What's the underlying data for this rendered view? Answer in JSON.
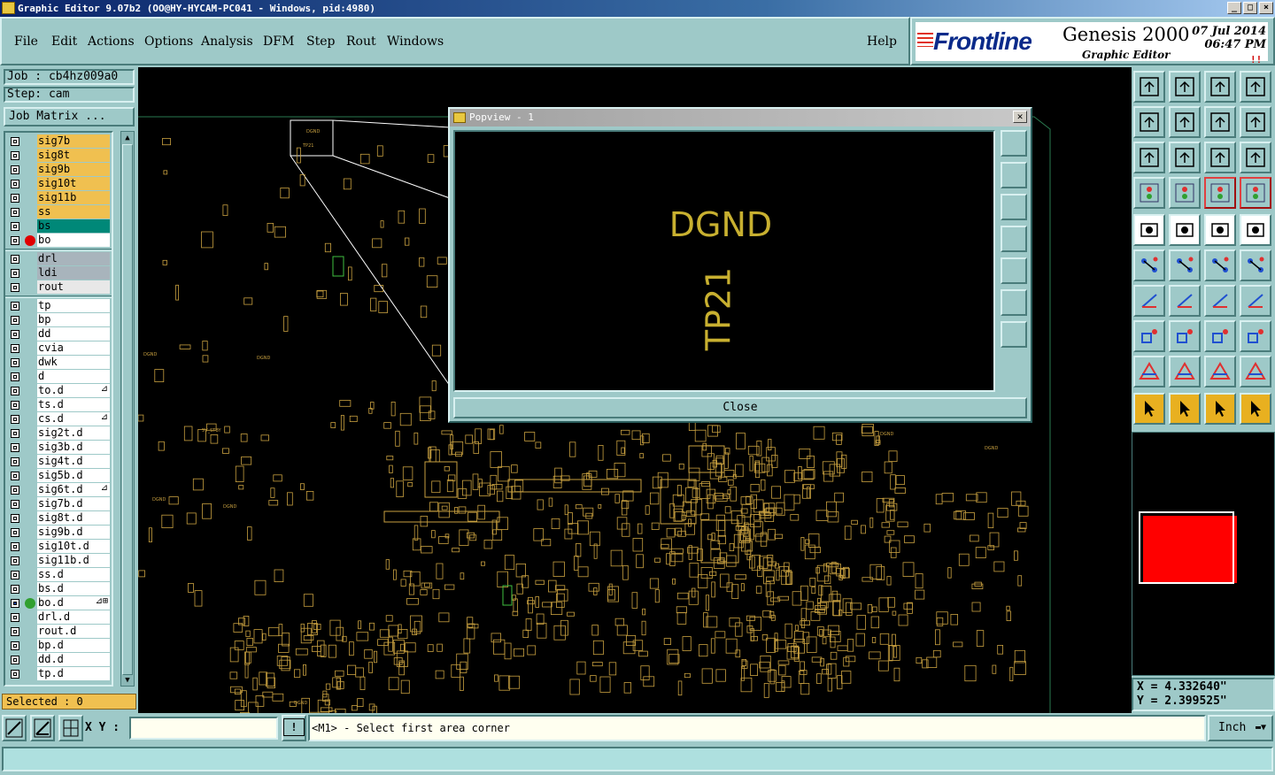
{
  "window": {
    "title": "Graphic Editor 9.07b2 (OO@HY-HYCAM-PC041 - Windows, pid:4980)",
    "controls": [
      "_",
      "□",
      "×"
    ]
  },
  "menu": [
    "File",
    "Edit",
    "Actions",
    "Options",
    "Analysis",
    "DFM",
    "Step",
    "Rout",
    "Windows"
  ],
  "help": "Help",
  "brand": {
    "logo": "Frontline",
    "product": "Genesis 2000",
    "subtitle": "Graphic Editor",
    "date": "07 Jul 2014",
    "time": "06:47 PM",
    "alarm": "!!"
  },
  "job": {
    "job_label": "Job : cb4hz009a0",
    "step_label": "Step: cam",
    "matrix_button": "Job Matrix ..."
  },
  "layers": {
    "group1": [
      {
        "name": "sig7b",
        "bg": "#f0c050"
      },
      {
        "name": "sig8t",
        "bg": "#f0c050"
      },
      {
        "name": "sig9b",
        "bg": "#f0c050"
      },
      {
        "name": "sig10t",
        "bg": "#f0c050"
      },
      {
        "name": "sig11b",
        "bg": "#f0c050"
      },
      {
        "name": "ss",
        "bg": "#f0c050"
      },
      {
        "name": "bs",
        "bg": "#008878"
      },
      {
        "name": "bo",
        "bg": "#ffffff",
        "dot": "#e00000"
      }
    ],
    "group2": [
      {
        "name": "drl",
        "bg": "#a8b4bc"
      },
      {
        "name": "ldi",
        "bg": "#a8b4bc"
      },
      {
        "name": "rout",
        "bg": "#e8e8e8"
      }
    ],
    "group3": [
      {
        "name": "tp"
      },
      {
        "name": "bp"
      },
      {
        "name": "dd"
      },
      {
        "name": "cvia"
      },
      {
        "name": "dwk"
      },
      {
        "name": "d"
      },
      {
        "name": "to.d",
        "mark": "⊿"
      },
      {
        "name": "ts.d"
      },
      {
        "name": "cs.d",
        "mark": "⊿"
      },
      {
        "name": "sig2t.d"
      },
      {
        "name": "sig3b.d"
      },
      {
        "name": "sig4t.d"
      },
      {
        "name": "sig5b.d"
      },
      {
        "name": "sig6t.d",
        "mark": "⊿"
      },
      {
        "name": "sig7b.d"
      },
      {
        "name": "sig8t.d"
      },
      {
        "name": "sig9b.d"
      },
      {
        "name": "sig10t.d"
      },
      {
        "name": "sig11b.d"
      },
      {
        "name": "ss.d"
      },
      {
        "name": "bs.d"
      },
      {
        "name": "bo.d",
        "mark": "⊿⊞",
        "dot": "#30a030",
        "active": true
      },
      {
        "name": "drl.d"
      },
      {
        "name": "rout.d"
      },
      {
        "name": "bp.d"
      },
      {
        "name": "dd.d"
      },
      {
        "name": "tp.d"
      }
    ]
  },
  "selected": "Selected : 0",
  "popview": {
    "title": "Popview - 1",
    "close_label": "Close",
    "text_top": "DGND",
    "text_rotated": "TP21"
  },
  "canvas_labels": [
    "DGND",
    "TP21",
    "DGND",
    "DGND",
    "DGND",
    "DGND",
    "DGND",
    "DGND",
    "5V_STBY",
    "DGND"
  ],
  "coords": {
    "x": "X = 4.332640\"",
    "y": "Y = 2.399525\""
  },
  "status": {
    "xy_label": "X Y :",
    "xy_value": "",
    "warn": "!",
    "prompt": "<M1> - Select first area corner",
    "units": "Inch"
  },
  "colors": {
    "pcb": "#c8a040",
    "board_outline": "#2a7a50",
    "popview_text": "#c8b030",
    "overview_red": "#ff0000"
  }
}
